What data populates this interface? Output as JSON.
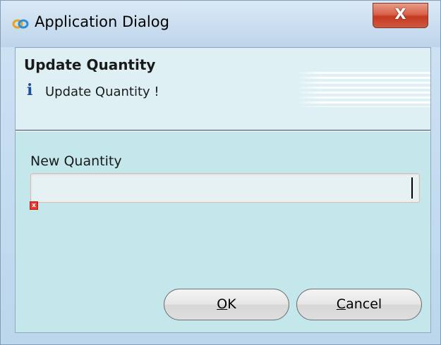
{
  "window": {
    "title": "Application Dialog",
    "app_icon": "link-chain-icon",
    "close_label": "X"
  },
  "header": {
    "title": "Update Quantity",
    "info_icon": "info-icon",
    "info_glyph": "i",
    "message": "Update Quantity !"
  },
  "form": {
    "quantity_label": "New Quantity",
    "quantity_value": "",
    "error_icon": "error-icon",
    "error_glyph": "x"
  },
  "buttons": {
    "ok": {
      "mnemonic": "O",
      "rest": "K"
    },
    "cancel": {
      "mnemonic": "C",
      "rest": "ancel"
    }
  },
  "colors": {
    "title_bar": "#c9ddef",
    "close_button": "#c43a22",
    "client_background": "#c4e7ec",
    "header_background": "#dff0f5",
    "info_icon": "#1f4e9c",
    "input_border": "#e2b9a6",
    "error_red": "#e8392f"
  }
}
